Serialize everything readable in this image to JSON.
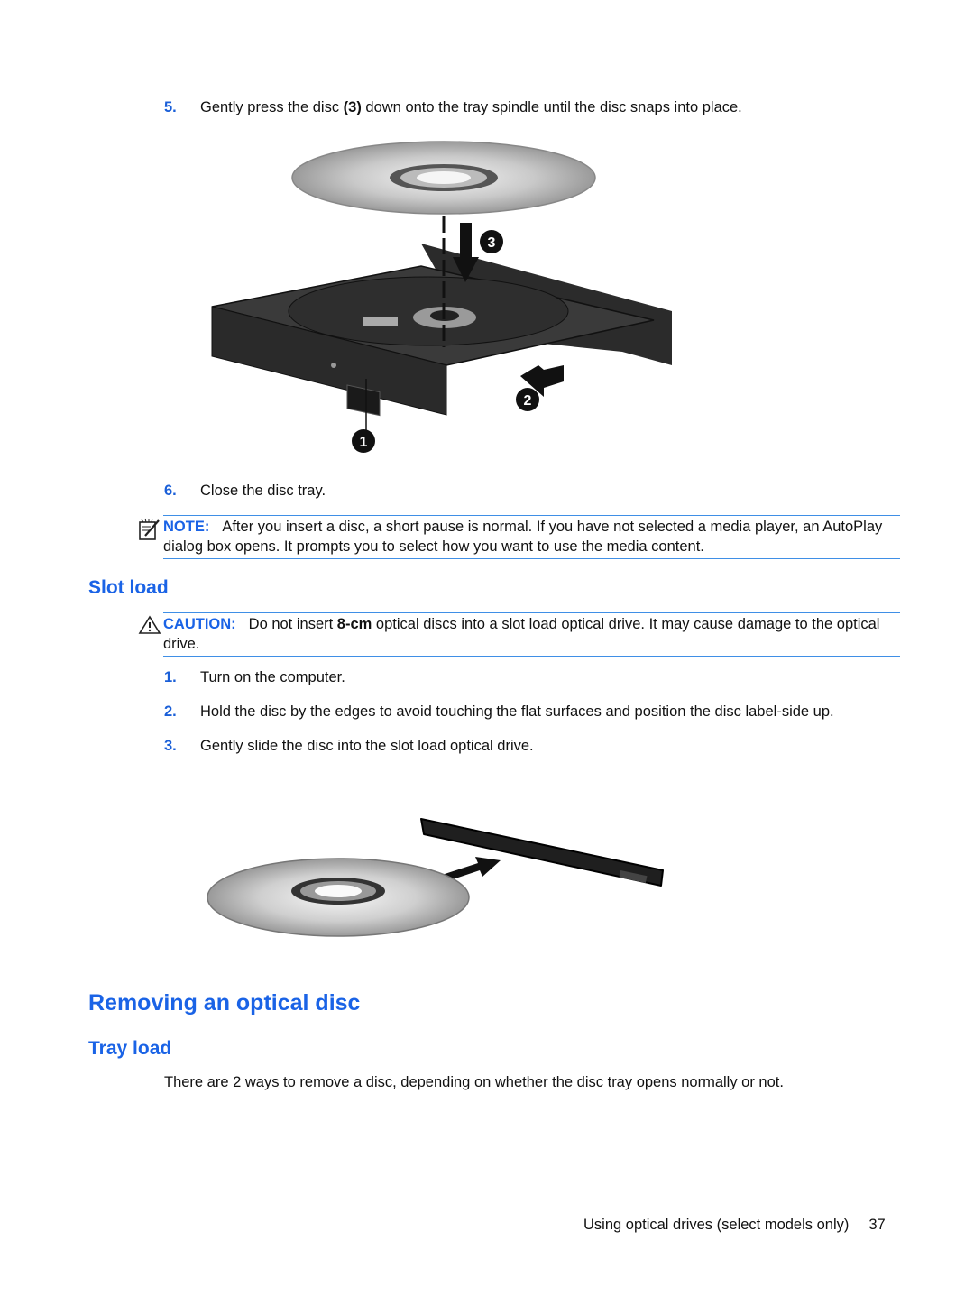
{
  "steps_top": [
    {
      "num": "5.",
      "pre": "Gently press the disc ",
      "bold": "(3)",
      "post": " down onto the tray spindle until the disc snaps into place."
    },
    {
      "num": "6.",
      "text": "Close the disc tray."
    }
  ],
  "figure_tray": {
    "callouts": [
      "1",
      "2",
      "3"
    ],
    "icon": "tray-load-optical-drive-illustration"
  },
  "note": {
    "icon": "note-pencil-icon",
    "label": "NOTE:",
    "text": "After you insert a disc, a short pause is normal. If you have not selected a media player, an AutoPlay dialog box opens. It prompts you to select how you want to use the media content."
  },
  "slot_load": {
    "heading": "Slot load",
    "caution": {
      "icon": "warning-triangle-icon",
      "label": "CAUTION:",
      "pre": "Do not insert ",
      "bold": "8-cm",
      "post": " optical discs into a slot load optical drive. It may cause damage to the optical drive."
    },
    "steps": [
      {
        "num": "1.",
        "text": "Turn on the computer."
      },
      {
        "num": "2.",
        "text": "Hold the disc by the edges to avoid touching the flat surfaces and position the disc label-side up."
      },
      {
        "num": "3.",
        "text": "Gently slide the disc into the slot load optical drive."
      }
    ],
    "figure_icon": "slot-load-drive-illustration"
  },
  "removing": {
    "heading": "Removing an optical disc",
    "subheading": "Tray load",
    "paragraph": "There are 2 ways to remove a disc, depending on whether the disc tray opens normally or not."
  },
  "footer": {
    "section": "Using optical drives (select models only)",
    "page": "37"
  }
}
